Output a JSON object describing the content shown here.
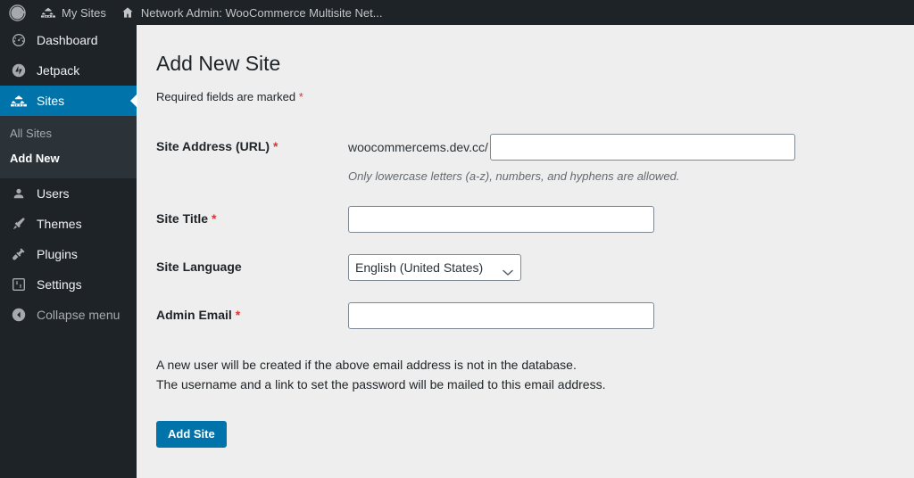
{
  "adminbar": {
    "items": [
      {
        "icon": "wordpress-logo-icon",
        "label": ""
      },
      {
        "icon": "my-sites-icon",
        "label": "My Sites"
      },
      {
        "icon": "network-home-icon",
        "label": "Network Admin: WooCommerce Multisite Net..."
      }
    ]
  },
  "sidebar": {
    "items": [
      {
        "label": "Dashboard",
        "icon": "dashboard-gauge-icon",
        "active": false
      },
      {
        "label": "Jetpack",
        "icon": "jetpack-icon",
        "active": false
      },
      {
        "label": "Sites",
        "icon": "sites-buildings-icon",
        "active": true
      },
      {
        "label": "Users",
        "icon": "users-icon",
        "active": false
      },
      {
        "label": "Themes",
        "icon": "themes-brush-icon",
        "active": false
      },
      {
        "label": "Plugins",
        "icon": "plugins-plug-icon",
        "active": false
      },
      {
        "label": "Settings",
        "icon": "settings-sliders-icon",
        "active": false
      },
      {
        "label": "Collapse menu",
        "icon": "collapse-arrow-icon",
        "active": false
      }
    ],
    "submenu": [
      {
        "label": "All Sites",
        "current": false
      },
      {
        "label": "Add New",
        "current": true
      }
    ]
  },
  "main": {
    "title": "Add New Site",
    "required_note": "Required fields are marked",
    "required_marker": "*",
    "fields": {
      "site_address": {
        "label": "Site Address (URL)",
        "required": true,
        "prefix": "woocommercems.dev.cc/",
        "value": "",
        "description": "Only lowercase letters (a-z), numbers, and hyphens are allowed."
      },
      "site_title": {
        "label": "Site Title",
        "required": true,
        "value": ""
      },
      "site_language": {
        "label": "Site Language",
        "required": false,
        "selected": "English (United States)",
        "options": [
          "English (United States)"
        ]
      },
      "admin_email": {
        "label": "Admin Email",
        "required": true,
        "value": ""
      }
    },
    "notes": [
      "A new user will be created if the above email address is not in the database.",
      "The username and a link to set the password will be mailed to this email address."
    ],
    "submit_label": "Add Site"
  },
  "colors": {
    "admin_blue": "#0073aa",
    "sidebar_dark": "#1d2327",
    "submenu_dark": "#2c3338",
    "content_bg": "#eeeeee",
    "required_red": "#d63638"
  }
}
